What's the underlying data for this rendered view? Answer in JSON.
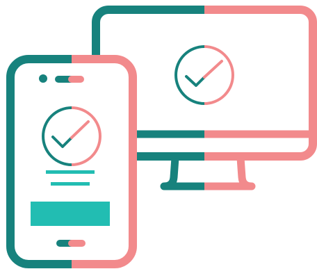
{
  "illustration": {
    "description_icons": [
      "desktop-monitor-icon",
      "smartphone-icon",
      "checkmark-icon"
    ],
    "colors": {
      "teal": "#17827D",
      "pink": "#F28A8C",
      "mint": "#22BDB2",
      "background": "#FFFFFF"
    }
  }
}
